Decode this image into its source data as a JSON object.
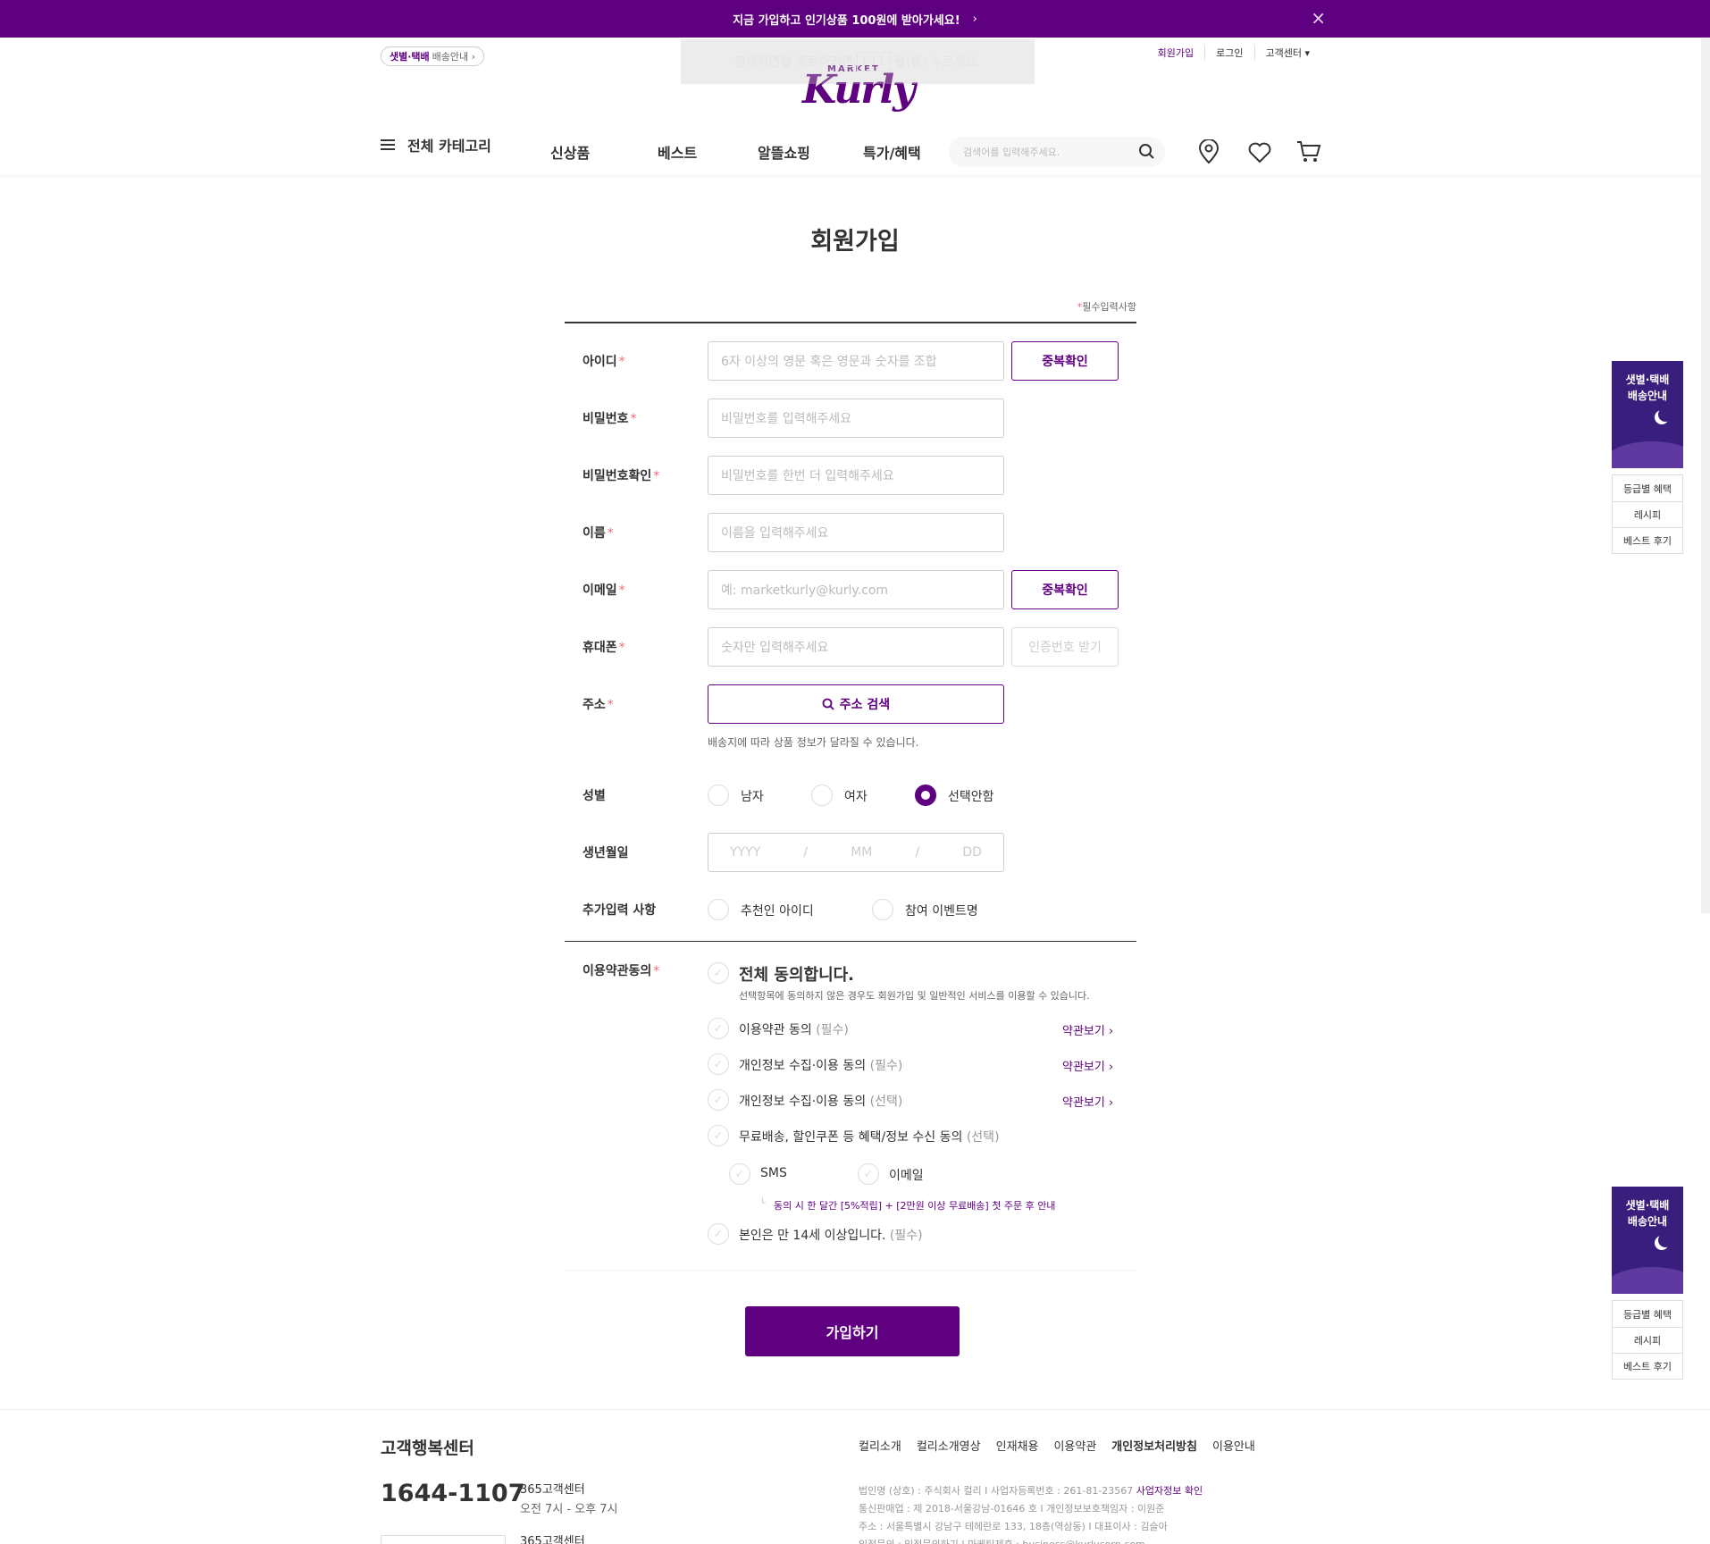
{
  "banner": {
    "text": "지금 가입하고 인기상품 100원에 받아가세요!",
    "chevron": "›",
    "close": "×"
  },
  "toast": {
    "pre": "전체화면을 종료하려면",
    "key": "F11",
    "post": "을(를) 누르세요."
  },
  "header": {
    "delivery_bold": "샛별·택배",
    "delivery_text": "배송안내 ›",
    "top_links": [
      "회원가입",
      "로그인",
      "고객센터 ▾"
    ],
    "logo_top": "MARKET",
    "logo": "Kurly",
    "nav": {
      "all": "전체 카테고리",
      "new": "신상품",
      "best": "베스트",
      "cheap": "알뜰쇼핑",
      "special": "특가/혜택"
    },
    "search_placeholder": "검색어를 입력해주세요."
  },
  "page": {
    "title": "회원가입",
    "required_note": "필수입력사항",
    "star": "*"
  },
  "form": {
    "id": {
      "label": "아이디",
      "placeholder": "6자 이상의 영문 혹은 영문과 숫자를 조합",
      "button": "중복확인"
    },
    "password": {
      "label": "비밀번호",
      "placeholder": "비밀번호를 입력해주세요"
    },
    "password_confirm": {
      "label": "비밀번호확인",
      "placeholder": "비밀번호를 한번 더 입력해주세요"
    },
    "name": {
      "label": "이름",
      "placeholder": "이름을 입력해주세요"
    },
    "email": {
      "label": "이메일",
      "placeholder": "예: marketkurly@kurly.com",
      "button": "중복확인"
    },
    "phone": {
      "label": "휴대폰",
      "placeholder": "숫자만 입력해주세요",
      "button": "인증번호 받기"
    },
    "address": {
      "label": "주소",
      "button": "주소 검색",
      "note": "배송지에 따라 상품 정보가 달라질 수 있습니다."
    },
    "gender": {
      "label": "성별",
      "options": [
        "남자",
        "여자",
        "선택안함"
      ],
      "selected": "선택안함"
    },
    "birth": {
      "label": "생년월일",
      "yyyy": "YYYY",
      "mm": "MM",
      "dd": "DD",
      "sep": "/"
    },
    "extra": {
      "label": "추가입력 사항",
      "options": [
        "추천인 아이디",
        "참여 이벤트명"
      ]
    }
  },
  "terms": {
    "label": "이용약관동의",
    "all": "전체 동의합니다.",
    "all_desc": "선택항목에 동의하지 않은 경우도 회원가입 및 일반적인 서비스를 이용할 수 있습니다.",
    "items": [
      {
        "text": "이용약관 동의",
        "tag": "(필수)",
        "link": "약관보기 ›"
      },
      {
        "text": "개인정보 수집·이용 동의",
        "tag": "(필수)",
        "link": "약관보기 ›"
      },
      {
        "text": "개인정보 수집·이용 동의",
        "tag": "(선택)",
        "link": "약관보기 ›"
      },
      {
        "text": "무료배송, 할인쿠폰 등 혜택/정보 수신 동의",
        "tag": "(선택)"
      }
    ],
    "sms": "SMS",
    "email": "이메일",
    "promo": "동의 시 한 달간 [5%적립] + [2만원 이상 무료배송] 첫 주문 후 안내",
    "age": {
      "text": "본인은 만 14세 이상입니다.",
      "tag": "(필수)"
    },
    "check": "✓"
  },
  "submit": "가입하기",
  "side": {
    "banner": "샛별·택배 배송안내",
    "items": [
      "등급별 혜택",
      "레시피",
      "베스트 후기"
    ]
  },
  "footer": {
    "cs_title": "고객행복센터",
    "phone": "1644-1107",
    "cs_label": "365고객센터",
    "hours": "오전 7시 - 오후 7시",
    "links": [
      "컬리소개",
      "컬리소개영상",
      "인재채용",
      "이용약관",
      "개인정보처리방침",
      "이용안내"
    ],
    "info1": "법인명 (상호) : 주식회사 컬리  I  사업자등록번호 : 261-81-23567",
    "info1_link": "사업자정보 확인",
    "info2": "통신판매업 : 제 2018-서울강남-01646 호  I  개인정보보호책임자 : 이원준",
    "info3": "주소 : 서울특별시 강남구 테헤란로 133, 18층(역삼동)  I  대표이사 : 김슬아",
    "info4": "입점문의 : 입점문의하기  I  마케팅제휴 : business@kurlycorp.com"
  },
  "colors": {
    "brand": "#5f0080",
    "required": "#ee6a7b"
  }
}
